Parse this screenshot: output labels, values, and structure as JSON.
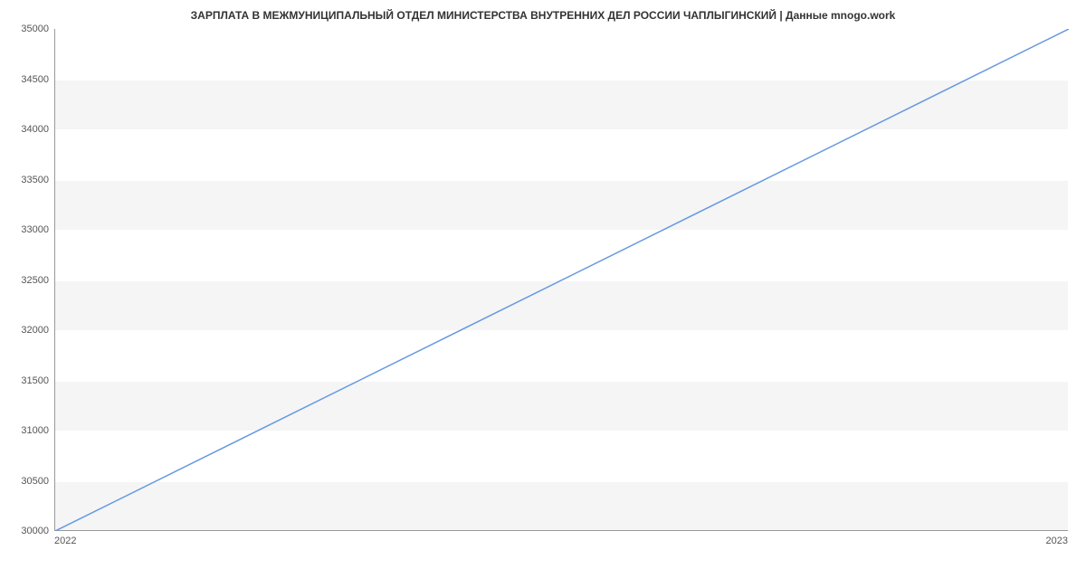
{
  "chart_data": {
    "type": "line",
    "title": "ЗАРПЛАТА В МЕЖМУНИЦИПАЛЬНЫЙ ОТДЕЛ МИНИСТЕРСТВА ВНУТРЕННИХ ДЕЛ РОССИИ ЧАПЛЫГИНСКИЙ | Данные mnogo.work",
    "x": [
      "2022",
      "2023"
    ],
    "values": [
      30000,
      35000
    ],
    "xlabel": "",
    "ylabel": "",
    "y_ticks": [
      30000,
      30500,
      31000,
      31500,
      32000,
      32500,
      33000,
      33500,
      34000,
      34500,
      35000
    ],
    "x_ticks": [
      "2022",
      "2023"
    ],
    "ylim": [
      30000,
      35000
    ],
    "line_color": "#6699e0"
  }
}
